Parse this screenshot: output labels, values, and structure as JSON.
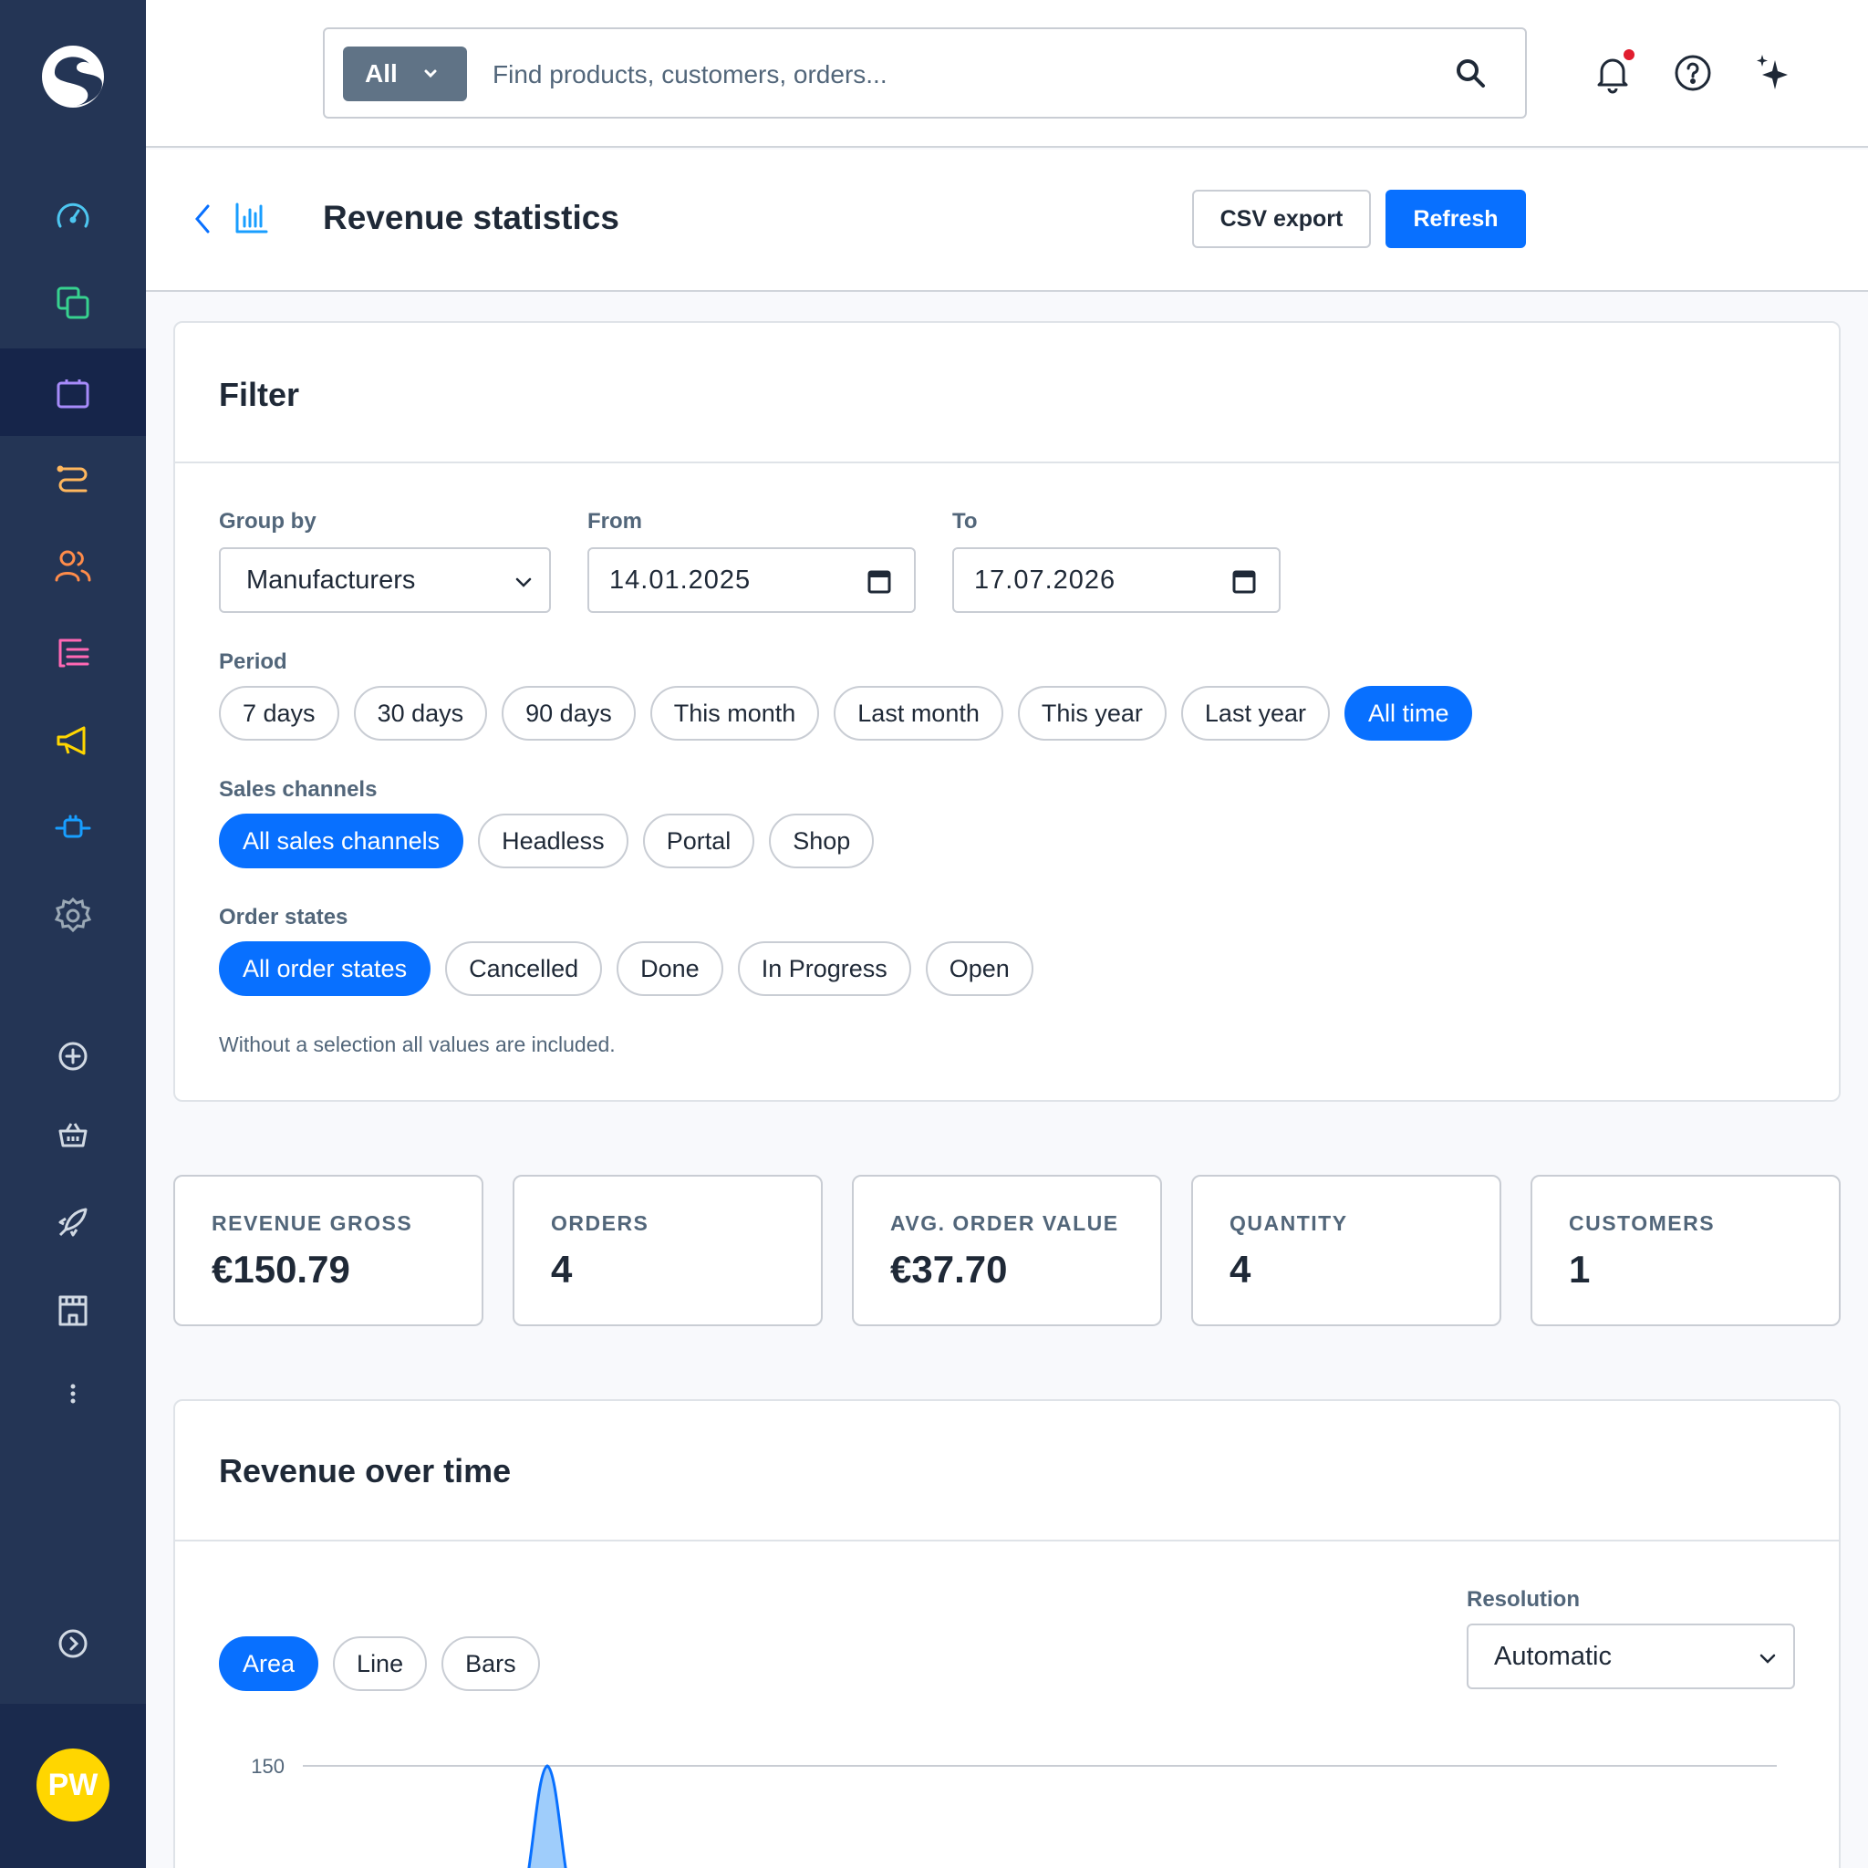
{
  "sidebar": {
    "items": [
      {
        "icon": "dashboard-icon",
        "color": "#4dc6f0"
      },
      {
        "icon": "catalogue-icon",
        "color": "#37d28f"
      },
      {
        "icon": "orders-icon",
        "color": "#a78bfa"
      },
      {
        "icon": "customers-flow-icon",
        "color": "#ffb75d"
      },
      {
        "icon": "customers-icon",
        "color": "#ff8c4a"
      },
      {
        "icon": "content-icon",
        "color": "#ff68b4"
      },
      {
        "icon": "marketing-icon",
        "color": "#ffd600"
      },
      {
        "icon": "extensions-icon",
        "color": "#189eff"
      },
      {
        "icon": "settings-icon",
        "color": "#9aa8b5"
      }
    ],
    "avatar_initials": "PW",
    "avatar_color": "#ffd600"
  },
  "search": {
    "scope": "All",
    "placeholder": "Find products, customers, orders..."
  },
  "header": {
    "title": "Revenue statistics",
    "csv_button": "CSV export",
    "refresh_button": "Refresh"
  },
  "filter": {
    "title": "Filter",
    "group_by_label": "Group by",
    "group_by_value": "Manufacturers",
    "from_label": "From",
    "from_value": "14.01.2025",
    "to_label": "To",
    "to_value": "17.07.2026",
    "period_label": "Period",
    "periods": [
      "7 days",
      "30 days",
      "90 days",
      "This month",
      "Last month",
      "This year",
      "Last year",
      "All time"
    ],
    "sales_channels_label": "Sales channels",
    "sales_channels": [
      "All sales channels",
      "Headless",
      "Portal",
      "Shop"
    ],
    "order_states_label": "Order states",
    "order_states": [
      "All order states",
      "Cancelled",
      "Done",
      "In Progress",
      "Open"
    ],
    "hint": "Without a selection all values are included."
  },
  "kpis": [
    {
      "label": "REVENUE GROSS",
      "value": "€150.79"
    },
    {
      "label": "ORDERS",
      "value": "4"
    },
    {
      "label": "AVG. ORDER VALUE",
      "value": "€37.70"
    },
    {
      "label": "QUANTITY",
      "value": "4"
    },
    {
      "label": "CUSTOMERS",
      "value": "1"
    }
  ],
  "revenue_chart": {
    "title": "Revenue over time",
    "chart_types": [
      "Area",
      "Line",
      "Bars"
    ],
    "resolution_label": "Resolution",
    "resolution_value": "Automatic"
  },
  "chart_data": {
    "type": "area",
    "ytick_labels": [
      "150"
    ],
    "peak_value": 150,
    "ylim": [
      0,
      150
    ],
    "grid": true,
    "color": "#0870ff"
  },
  "colors": {
    "accent": "#0870ff",
    "sidebar": "#243555"
  }
}
